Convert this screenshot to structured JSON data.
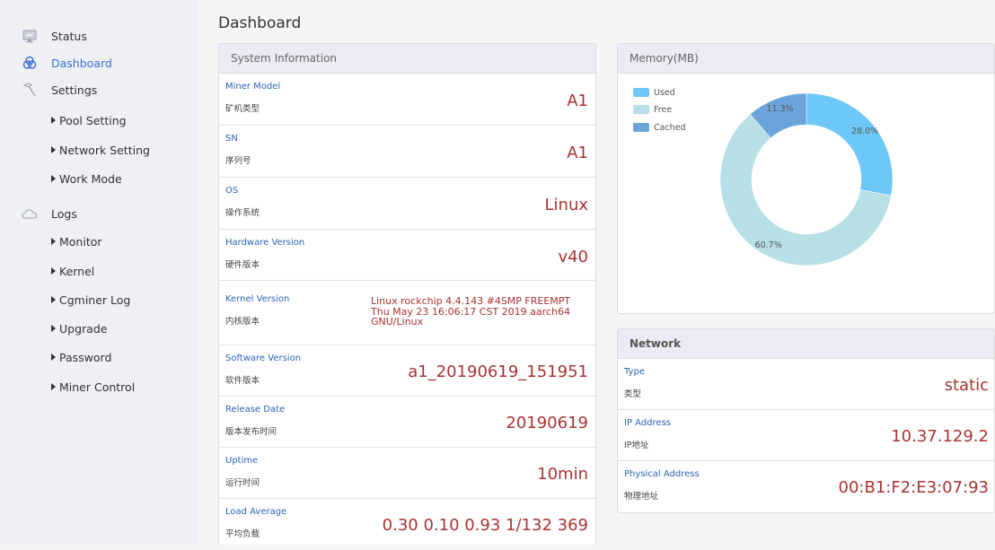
{
  "sidebar": {
    "items": [
      {
        "key": "status",
        "label": "Status",
        "icon": "monitor-icon"
      },
      {
        "key": "dashboard",
        "label": "Dashboard",
        "icon": "dashboard-icon",
        "active": true
      },
      {
        "key": "settings",
        "label": "Settings",
        "icon": "hammer-icon"
      },
      {
        "key": "logs",
        "label": "Logs",
        "icon": "cloud-icon"
      }
    ],
    "settings_sub": [
      "Pool Setting",
      "Network Setting",
      "Work Mode"
    ],
    "logs_sub": [
      "Monitor",
      "Kernel",
      "Cgminer Log",
      "Upgrade",
      "Password",
      "Miner Control"
    ]
  },
  "page": {
    "title": "Dashboard"
  },
  "system_info": {
    "header": "System Information",
    "rows": [
      {
        "en": "Miner Model",
        "zh": "矿机类型",
        "value": "A1"
      },
      {
        "en": "SN",
        "zh": "序列号",
        "value": "A1"
      },
      {
        "en": "OS",
        "zh": "操作系统",
        "value": "Linux"
      },
      {
        "en": "Hardware Version",
        "zh": "硬件版本",
        "value": "v40"
      },
      {
        "en": "Kernel Version",
        "zh": "内核版本",
        "value": "Linux rockchip 4.4.143 #4SMP FREEMPT Thu May 23 16:06:17 CST 2019 aarch64 GNU/Linux"
      },
      {
        "en": "Software Version",
        "zh": "软件版本",
        "value": "a1_20190619_151951"
      },
      {
        "en": "Release Date",
        "zh": "版本发布时间",
        "value": "20190619"
      },
      {
        "en": "Uptime",
        "zh": "运行时间",
        "value": "10min"
      },
      {
        "en": "Load Average",
        "zh": "平均负载",
        "value": "0.30 0.10 0.93 1/132 369"
      }
    ]
  },
  "memory": {
    "header": "Memory(MB)",
    "legend": [
      {
        "label": "Used",
        "color": "#6ec8f7"
      },
      {
        "label": "Free",
        "color": "#b7e0e6"
      },
      {
        "label": "Cached",
        "color": "#6aa4db"
      }
    ],
    "slices": [
      {
        "label": "Used",
        "percent": 28.0,
        "text": "28.0%",
        "color": "#6ec8f7"
      },
      {
        "label": "Free",
        "percent": 60.7,
        "text": "60.7%",
        "color": "#b7e0e6"
      },
      {
        "label": "Cached",
        "percent": 11.3,
        "text": "11.3%",
        "color": "#6aa4db"
      }
    ]
  },
  "network": {
    "header": "Network",
    "rows": [
      {
        "en": "Type",
        "zh": "类型",
        "value": "static"
      },
      {
        "en": "IP Address",
        "zh": "IP地址",
        "value": "10.37.129.2"
      },
      {
        "en": "Physical Address",
        "zh": "物理地址",
        "value": "00:B1:F2:E3:07:93"
      }
    ]
  },
  "colors": {
    "accent": "#3a6fd0",
    "label_blue": "#2b63b4",
    "value_red": "#a83232",
    "panel_header": "#ebebf5"
  }
}
